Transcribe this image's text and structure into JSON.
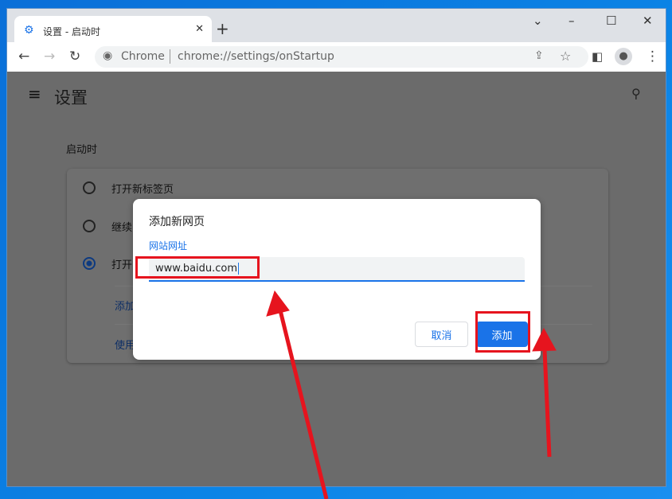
{
  "browser": {
    "tab_title": "设置 - 启动时",
    "omnibox_site": "Chrome",
    "omnibox_url": "chrome://settings/onStartup"
  },
  "settings": {
    "page_title": "设置",
    "section_title": "启动时",
    "options": [
      {
        "label": "打开新标签页",
        "selected": false
      },
      {
        "label": "继续",
        "selected": false
      },
      {
        "label": "打开",
        "selected": true
      }
    ],
    "links": [
      "添加",
      "使用"
    ]
  },
  "dialog": {
    "title": "添加新网页",
    "field_label": "网站网址",
    "field_value": "www.baidu.com",
    "cancel_label": "取消",
    "add_label": "添加"
  },
  "colors": {
    "accent": "#1a73e8",
    "annotation": "#e6141e"
  }
}
